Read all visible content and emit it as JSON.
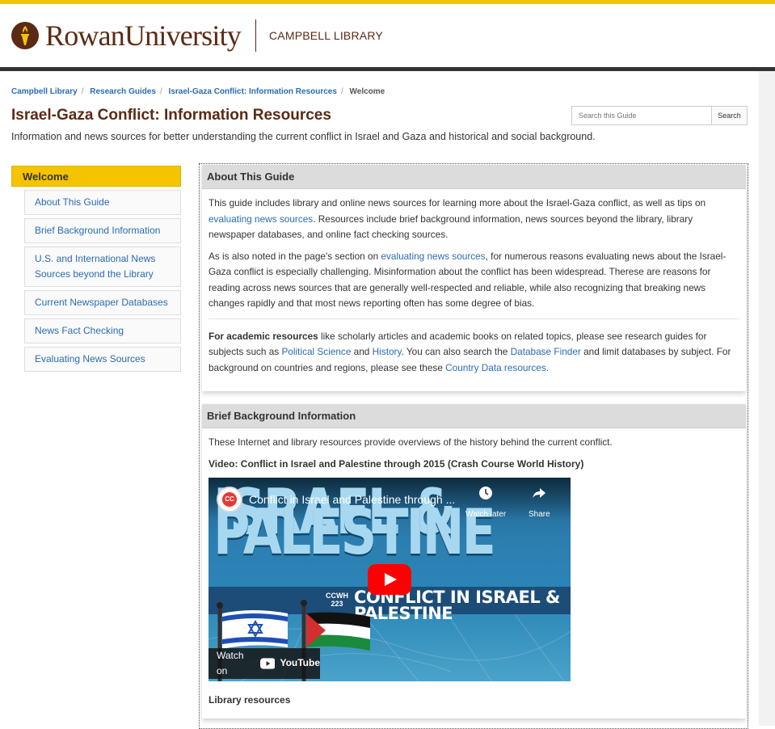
{
  "header": {
    "university": "RowanUniversity",
    "library": "CAMPBELL LIBRARY"
  },
  "breadcrumb": [
    "Campbell Library",
    "Research Guides",
    "Israel-Gaza Conflict: Information Resources",
    "Welcome"
  ],
  "guide": {
    "title": "Israel-Gaza Conflict: Information Resources",
    "description": "Information and news sources for better understanding the current conflict in Israel and Gaza and historical and social background."
  },
  "search": {
    "placeholder": "Search this Guide",
    "button": "Search"
  },
  "sidenav": {
    "active": "Welcome",
    "items": [
      {
        "label": "About This Guide"
      },
      {
        "label": "Brief Background Information"
      },
      {
        "label": "U.S. and International News Sources beyond the Library"
      },
      {
        "label": "Current Newspaper Databases"
      },
      {
        "label": "News Fact Checking"
      },
      {
        "label": "Evaluating News Sources"
      }
    ]
  },
  "about": {
    "heading": "About This Guide",
    "p1_a": "This guide includes library and online news sources for learning more about the Israel-Gaza conflict, as well as tips on ",
    "p1_link": "evaluating news sources",
    "p1_b": ". Resources include brief background information, news sources beyond the library, library newspaper databases, and online fact checking sources.",
    "p2_a": "As is also noted in the page's section on ",
    "p2_link": "evaluating news sources",
    "p2_b": ", for numerous reasons evaluating news about the Israel-Gaza conflict is especially challenging. Misinformation about the conflict has been widespread. Therese are reasons for reading across news sources that are generally well-respected and reliable, while also recognizing that breaking news changes rapidly and that most news reporting often has some degree of bias.",
    "p3_bold": "For academic resources",
    "p3_a": " like scholarly articles and academic books on related topics, please see research guides for subjects such as ",
    "p3_link1": "Political Science",
    "p3_and": " and ",
    "p3_link2": "History",
    "p3_b": ". You can also search the ",
    "p3_link3": "Database Finder",
    "p3_c": " and limit databases by subject. For background on countries and regions, please see these ",
    "p3_link4": "Country Data resources",
    "p3_d": "."
  },
  "background": {
    "heading": "Brief Background Information",
    "intro": "These Internet and library resources provide overviews of the history behind the current conflict.",
    "video_title": "Video: Conflict in Israel and Palestine through 2015 (Crash Course World History)",
    "video": {
      "channel_logo": "CC",
      "heading": "Conflict in Israel and Palestine through ...",
      "watch_later": "Watch later",
      "share": "Share",
      "big_title": "ISRAEL & PALESTINE",
      "ccwh": "CCWH",
      "episode": "223",
      "subtitle": "CONFLICT IN ISRAEL & PALESTINE",
      "watch_on": "Watch on",
      "youtube": "YouTube"
    },
    "library_resources": "Library resources"
  },
  "colors": {
    "gold": "#f5c400",
    "maroon": "#5b2a14",
    "link": "#2b6cb0",
    "heading_bg": "#dcdcdc"
  }
}
